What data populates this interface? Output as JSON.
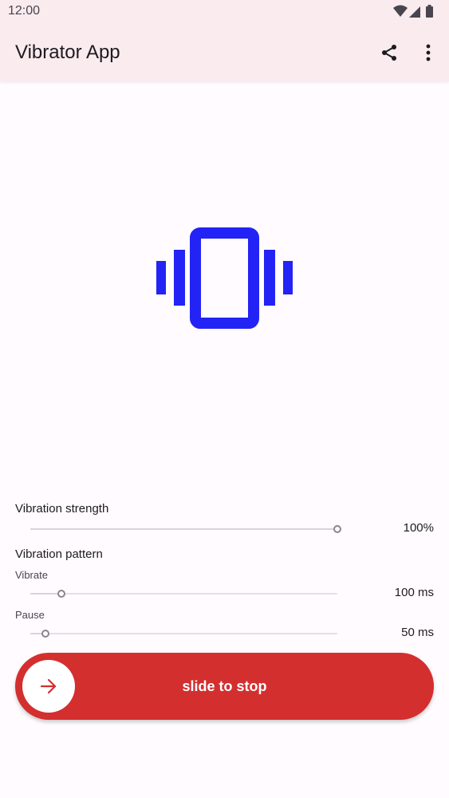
{
  "status_bar": {
    "time": "12:00"
  },
  "app_bar": {
    "title": "Vibrator App",
    "share_icon": "share-icon",
    "more_icon": "more-vert-icon"
  },
  "colors": {
    "brand_blue": "#2323f5",
    "slide_red": "#d32f2f",
    "app_bar_bg": "#f9ebee"
  },
  "hero": {
    "icon": "vibration-icon"
  },
  "strength": {
    "label": "Vibration strength",
    "value_text": "100%",
    "fraction": 1.0
  },
  "pattern": {
    "label": "Vibration pattern",
    "vibrate": {
      "label": "Vibrate",
      "value_text": "100 ms",
      "fraction": 0.1
    },
    "pause": {
      "label": "Pause",
      "value_text": "50 ms",
      "fraction": 0.05
    }
  },
  "slide_control": {
    "label": "slide to stop",
    "handle_icon": "arrow-right-icon"
  }
}
